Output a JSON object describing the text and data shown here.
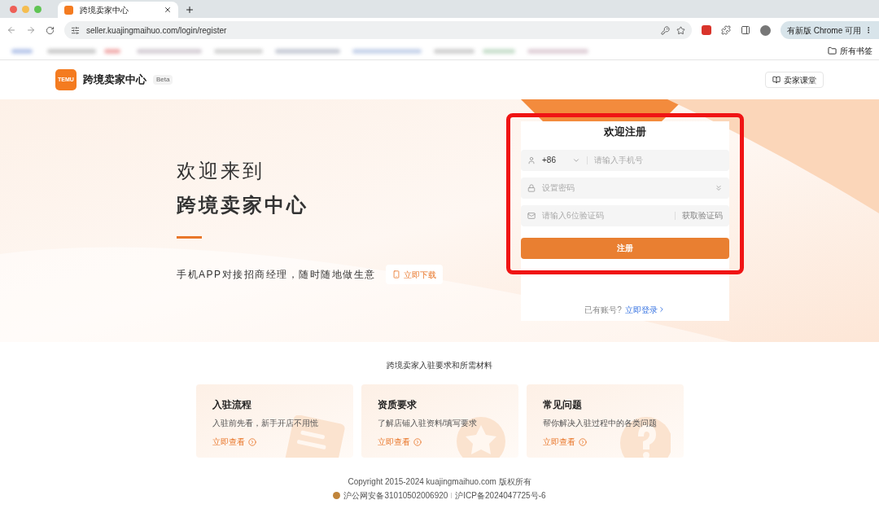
{
  "browser": {
    "tab": {
      "title": "跨境卖家中心",
      "selected": true
    },
    "url": "seller.kuajingmaihuo.com/login/register",
    "update_button": "有新版 Chrome 可用",
    "all_bookmarks": "所有书签"
  },
  "header": {
    "logo_text": "TEMU",
    "site_name": "跨境卖家中心",
    "badge": "Beta",
    "classroom_button": "卖家课堂"
  },
  "hero": {
    "welcome": "欢迎来到",
    "title": "跨境卖家中心",
    "tagline": "手机APP对接招商经理，随时随地做生意",
    "download_button": "立即下载"
  },
  "register_form": {
    "title": "欢迎注册",
    "country_code": "+86",
    "phone_placeholder": "请输入手机号",
    "password_placeholder": "设置密码",
    "code_placeholder": "请输入6位验证码",
    "get_code_button": "获取验证码",
    "submit_button": "注册",
    "have_account": "已有账号?",
    "login_link": "立即登录",
    "highlighted": true
  },
  "requirements": {
    "title": "跨境卖家入驻要求和所需材料",
    "cards": [
      {
        "kind": "document",
        "title": "入驻流程",
        "description": "入驻前先看，新手开店不用慌",
        "link": "立即查看"
      },
      {
        "kind": "star",
        "title": "资质要求",
        "description": "了解店铺入驻资料/填写要求",
        "link": "立即查看"
      },
      {
        "kind": "question",
        "title": "常见问题",
        "description": "帮你解决入驻过程中的各类问题",
        "link": "立即查看"
      }
    ]
  },
  "footer": {
    "copyright": "Copyright 2015-2024 kuajingmaihuo.com 版权所有",
    "police_record": "沪公网安备31010502006920",
    "icp_record": "沪ICP备2024047725号-6"
  }
}
